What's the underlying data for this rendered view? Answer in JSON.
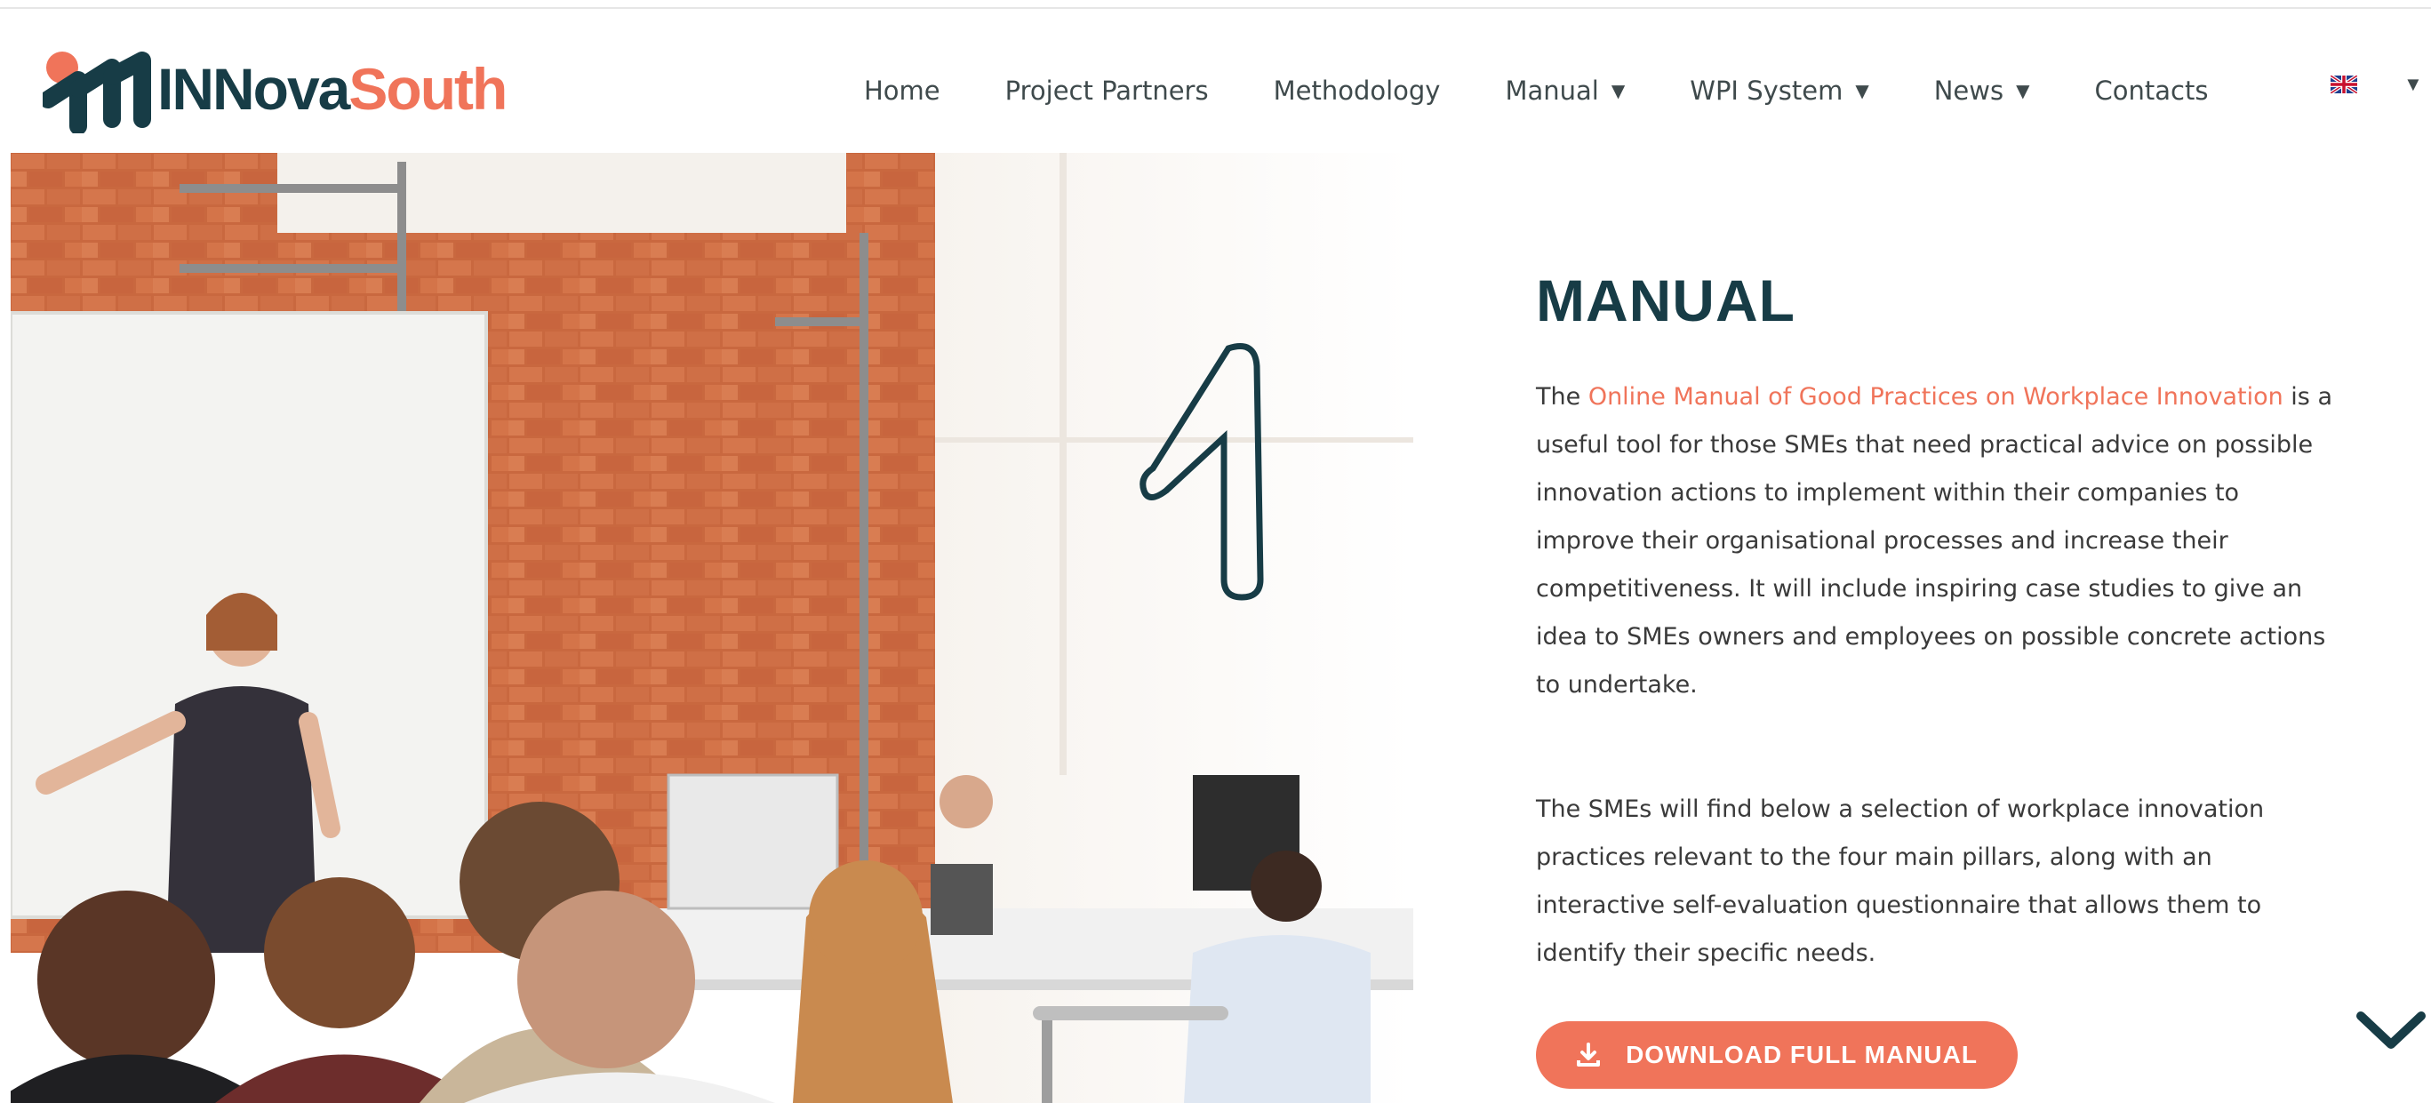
{
  "header": {
    "logo": {
      "text_dark": "INNova",
      "text_accent": "South",
      "icon": "innovasouth-logo-mark"
    },
    "nav": [
      {
        "label": "Home",
        "has_dropdown": false
      },
      {
        "label": "Project Partners",
        "has_dropdown": false
      },
      {
        "label": "Methodology",
        "has_dropdown": false
      },
      {
        "label": "Manual",
        "has_dropdown": true
      },
      {
        "label": "WPI System",
        "has_dropdown": true
      },
      {
        "label": "News",
        "has_dropdown": true
      },
      {
        "label": "Contacts",
        "has_dropdown": false
      }
    ],
    "language": {
      "icon": "uk-flag-icon",
      "has_dropdown": true
    }
  },
  "hero": {
    "image_icon": "presentation-photo",
    "title": "MANUAL",
    "intro_before_link": "The ",
    "link_text": "Online Manual of Good Practices on Workplace Innovation",
    "intro_after_link": " is a useful tool for those SMEs that need practical advice on possible innovation actions to implement within their companies to improve their organisational processes and increase their competitiveness. It will include inspiring case studies to give an idea to SMEs owners and employees on possible concrete actions to undertake.",
    "paragraph2": "The SMEs will find below a selection of workplace innovation practices relevant to the four main pillars, along with an interactive self-evaluation questionnaire that allows them to identify their specific needs.",
    "download_button": {
      "label": "DOWNLOAD FULL MANUAL",
      "icon": "download-icon"
    },
    "scroll_icon": "chevron-down-icon"
  },
  "colors": {
    "brand_dark": "#173c46",
    "brand_accent": "#f0745a",
    "text": "#3a3a3a"
  }
}
